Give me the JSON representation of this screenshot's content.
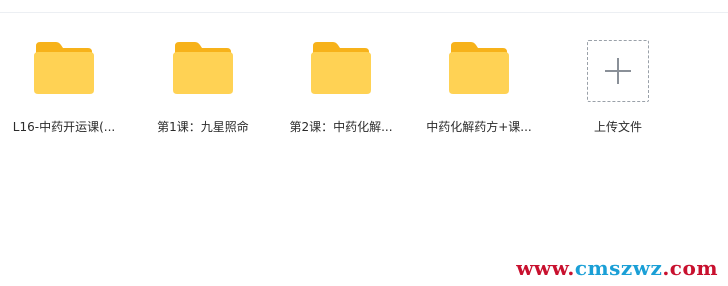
{
  "folders": [
    {
      "label": "L16-中药开运课(...",
      "icon": "folder-icon"
    },
    {
      "label": "第1课：九星照命",
      "icon": "folder-icon"
    },
    {
      "label": "第2课：中药化解...",
      "icon": "folder-icon"
    },
    {
      "label": "中药化解药方+课...",
      "icon": "folder-icon"
    }
  ],
  "upload": {
    "label": "上传文件",
    "icon": "plus-icon"
  },
  "watermark": {
    "part1": "www.",
    "part2": "cmszwz",
    "part3": ".com"
  },
  "colors": {
    "folder_back": "#f7b21a",
    "folder_front": "#ffd254",
    "border_dashed": "#9aa1a9",
    "watermark_red": "#c8102e",
    "watermark_blue": "#1a9fd6"
  }
}
